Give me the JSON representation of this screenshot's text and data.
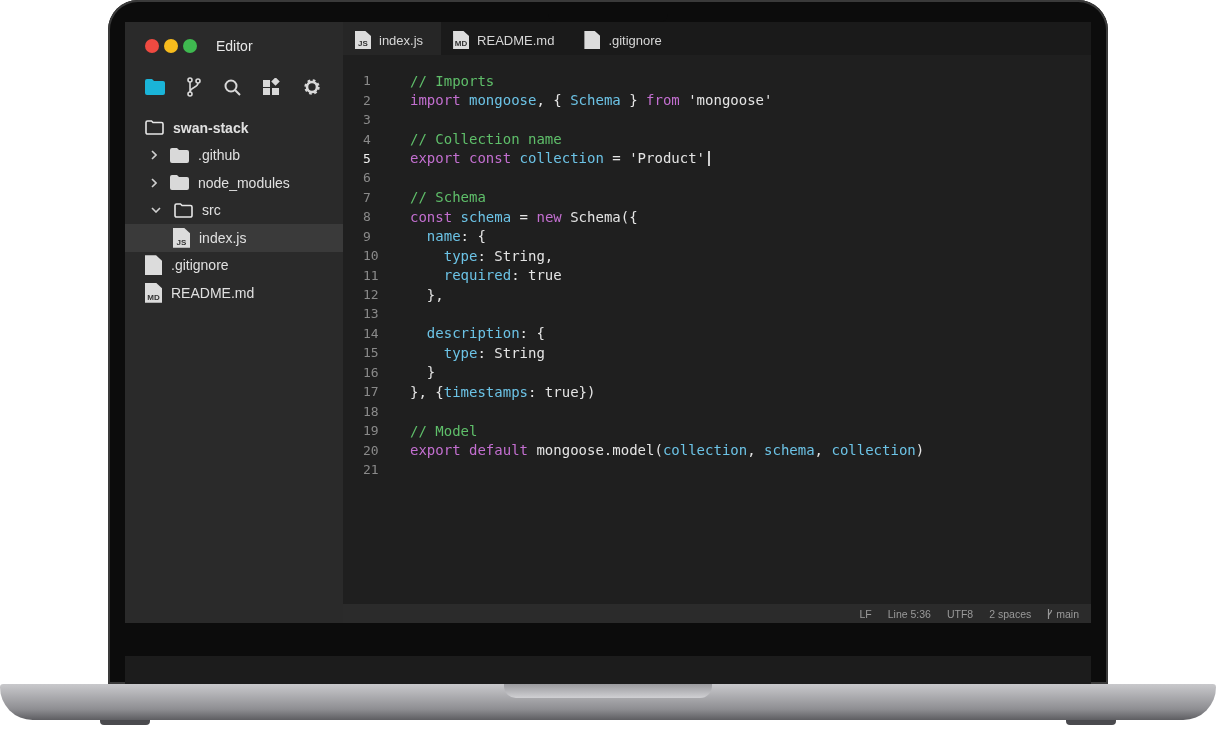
{
  "window": {
    "title": "Editor"
  },
  "activity_bar": [
    {
      "kind": "folder",
      "selected": true
    },
    {
      "kind": "branch",
      "selected": false
    },
    {
      "kind": "search",
      "selected": false
    },
    {
      "kind": "extensions",
      "selected": false
    },
    {
      "kind": "settings",
      "selected": false
    }
  ],
  "file_tree": [
    {
      "label": "swan-stack",
      "kind": "root",
      "children": [
        {
          "label": ".github",
          "kind": "folder",
          "expanded": false
        },
        {
          "label": "node_modules",
          "kind": "folder",
          "expanded": false
        },
        {
          "label": "src",
          "kind": "folder",
          "expanded": true,
          "children": [
            {
              "label": "index.js",
              "kind": "file",
              "badge": "JS",
              "selected": true
            }
          ]
        },
        {
          "label": ".gitignore",
          "kind": "file",
          "selected": false
        },
        {
          "label": "README.md",
          "kind": "file",
          "badge": "MD",
          "selected": false
        }
      ]
    }
  ],
  "tabs": [
    {
      "label": "index.js",
      "badge": "JS",
      "selected": true
    },
    {
      "label": "README.md",
      "badge": "MD",
      "selected": false
    },
    {
      "label": ".gitignore",
      "selected": false
    }
  ],
  "code_lines": [
    {
      "number": "1",
      "active": false,
      "tokens": [
        {
          "t": "// Imports",
          "kind": "comment"
        }
      ]
    },
    {
      "number": "2",
      "active": false,
      "tokens": [
        {
          "t": "import ",
          "kind": "keyword"
        },
        {
          "t": "mongoose",
          "kind": "ident"
        },
        {
          "t": ", { ",
          "kind": "plain"
        },
        {
          "t": "Schema",
          "kind": "ident"
        },
        {
          "t": " } ",
          "kind": "plain"
        },
        {
          "t": "from",
          "kind": "keyword"
        },
        {
          "t": " 'mongoose'",
          "kind": "plain"
        }
      ]
    },
    {
      "number": "3",
      "active": false
    },
    {
      "number": "4",
      "active": false,
      "tokens": [
        {
          "t": "// Collection name",
          "kind": "comment"
        }
      ]
    },
    {
      "number": "5",
      "active": true,
      "tokens": [
        {
          "t": "export const ",
          "kind": "keyword"
        },
        {
          "t": "collection",
          "kind": "ident"
        },
        {
          "t": " = 'Product'",
          "kind": "plain"
        }
      ]
    },
    {
      "number": "6",
      "active": false
    },
    {
      "number": "7",
      "active": false,
      "tokens": [
        {
          "t": "// Schema",
          "kind": "comment"
        }
      ]
    },
    {
      "number": "8",
      "active": false,
      "tokens": [
        {
          "t": "const ",
          "kind": "keyword"
        },
        {
          "t": "schema",
          "kind": "ident"
        },
        {
          "t": " = ",
          "kind": "plain"
        },
        {
          "t": "new",
          "kind": "keyword"
        },
        {
          "t": " Schema({",
          "kind": "plain"
        }
      ]
    },
    {
      "number": "9",
      "active": false,
      "tokens": [
        {
          "t": "  name",
          "kind": "ident"
        },
        {
          "t": ": {",
          "kind": "plain"
        }
      ]
    },
    {
      "number": "10",
      "active": false,
      "tokens": [
        {
          "t": "    type",
          "kind": "ident"
        },
        {
          "t": ": String,",
          "kind": "plain"
        }
      ]
    },
    {
      "number": "11",
      "active": false,
      "tokens": [
        {
          "t": "    required",
          "kind": "ident"
        },
        {
          "t": ": true",
          "kind": "plain"
        }
      ]
    },
    {
      "number": "12",
      "active": false,
      "tokens": [
        {
          "t": "  },",
          "kind": "plain"
        }
      ]
    },
    {
      "number": "13",
      "active": false
    },
    {
      "number": "14",
      "active": false,
      "tokens": [
        {
          "t": "  description",
          "kind": "ident"
        },
        {
          "t": ": {",
          "kind": "plain"
        }
      ]
    },
    {
      "number": "15",
      "active": false,
      "tokens": [
        {
          "t": "    type",
          "kind": "ident"
        },
        {
          "t": ": String",
          "kind": "plain"
        }
      ]
    },
    {
      "number": "16",
      "active": false,
      "tokens": [
        {
          "t": "  }",
          "kind": "plain"
        }
      ]
    },
    {
      "number": "17",
      "active": false,
      "tokens": [
        {
          "t": "}, {",
          "kind": "plain"
        },
        {
          "t": "timestamps",
          "kind": "ident"
        },
        {
          "t": ": true})",
          "kind": "plain"
        }
      ]
    },
    {
      "number": "18",
      "active": false
    },
    {
      "number": "19",
      "active": false,
      "tokens": [
        {
          "t": "// Model",
          "kind": "comment"
        }
      ]
    },
    {
      "number": "20",
      "active": false,
      "tokens": [
        {
          "t": "export default",
          "kind": "keyword"
        },
        {
          "t": " mongoose.model(",
          "kind": "plain"
        },
        {
          "t": "collection",
          "kind": "ident"
        },
        {
          "t": ", ",
          "kind": "plain"
        },
        {
          "t": "schema",
          "kind": "ident"
        },
        {
          "t": ", ",
          "kind": "plain"
        },
        {
          "t": "collection",
          "kind": "ident"
        },
        {
          "t": ")",
          "kind": "plain"
        }
      ]
    },
    {
      "number": "21",
      "active": false
    }
  ],
  "status_bar": [
    {
      "label": "LF",
      "kind": "text"
    },
    {
      "label": "Line 5:36",
      "kind": "text"
    },
    {
      "label": "UTF8",
      "kind": "text"
    },
    {
      "label": "2 spaces",
      "kind": "text"
    },
    {
      "label": "main",
      "kind": "branch"
    }
  ]
}
